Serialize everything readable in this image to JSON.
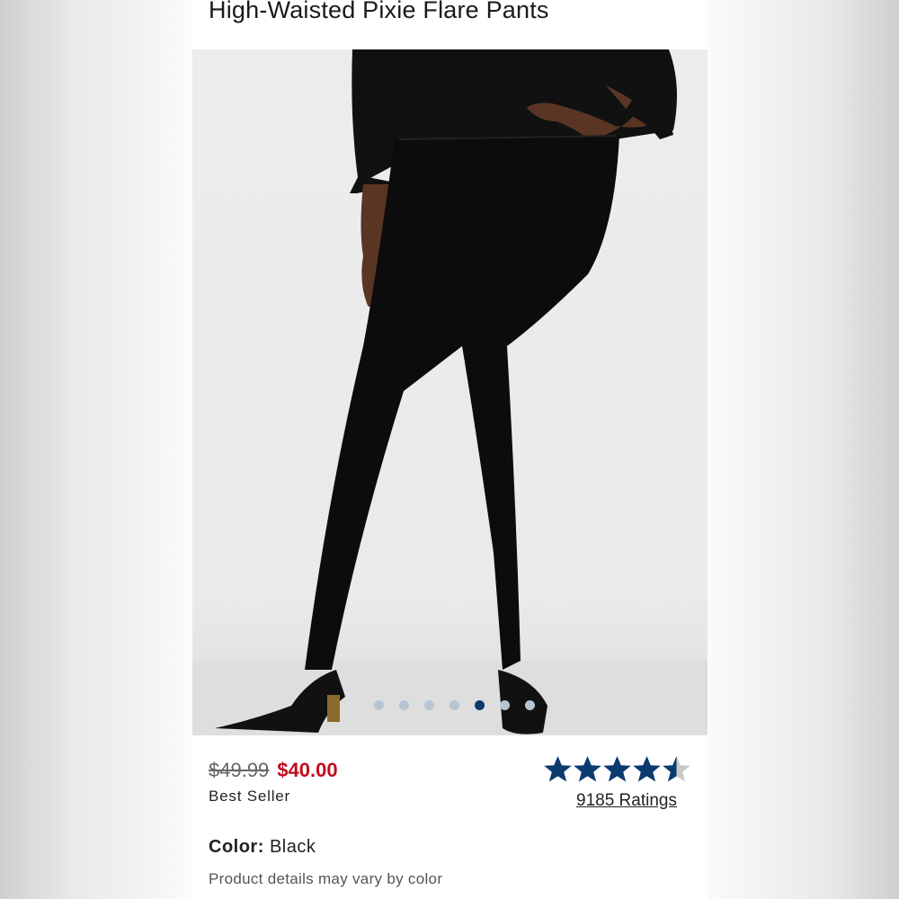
{
  "product": {
    "title": "High-Waisted Pixie Flare Pants",
    "image_alt": "model-wearing-black-flare-pants"
  },
  "carousel": {
    "total": 7,
    "active_index": 4,
    "active_color": "#0a3a6e",
    "inactive_color": "#b7c5d3"
  },
  "pricing": {
    "original_price": "$49.99",
    "sale_price": "$40.00",
    "sale_color": "#c00d1e",
    "badge": "Best Seller"
  },
  "rating": {
    "stars": 4.5,
    "max_stars": 5,
    "star_color": "#0a3a6e",
    "ratings_label": "9185 Ratings"
  },
  "color": {
    "label": "Color:",
    "value": " Black"
  },
  "note": "Product details may vary by color"
}
